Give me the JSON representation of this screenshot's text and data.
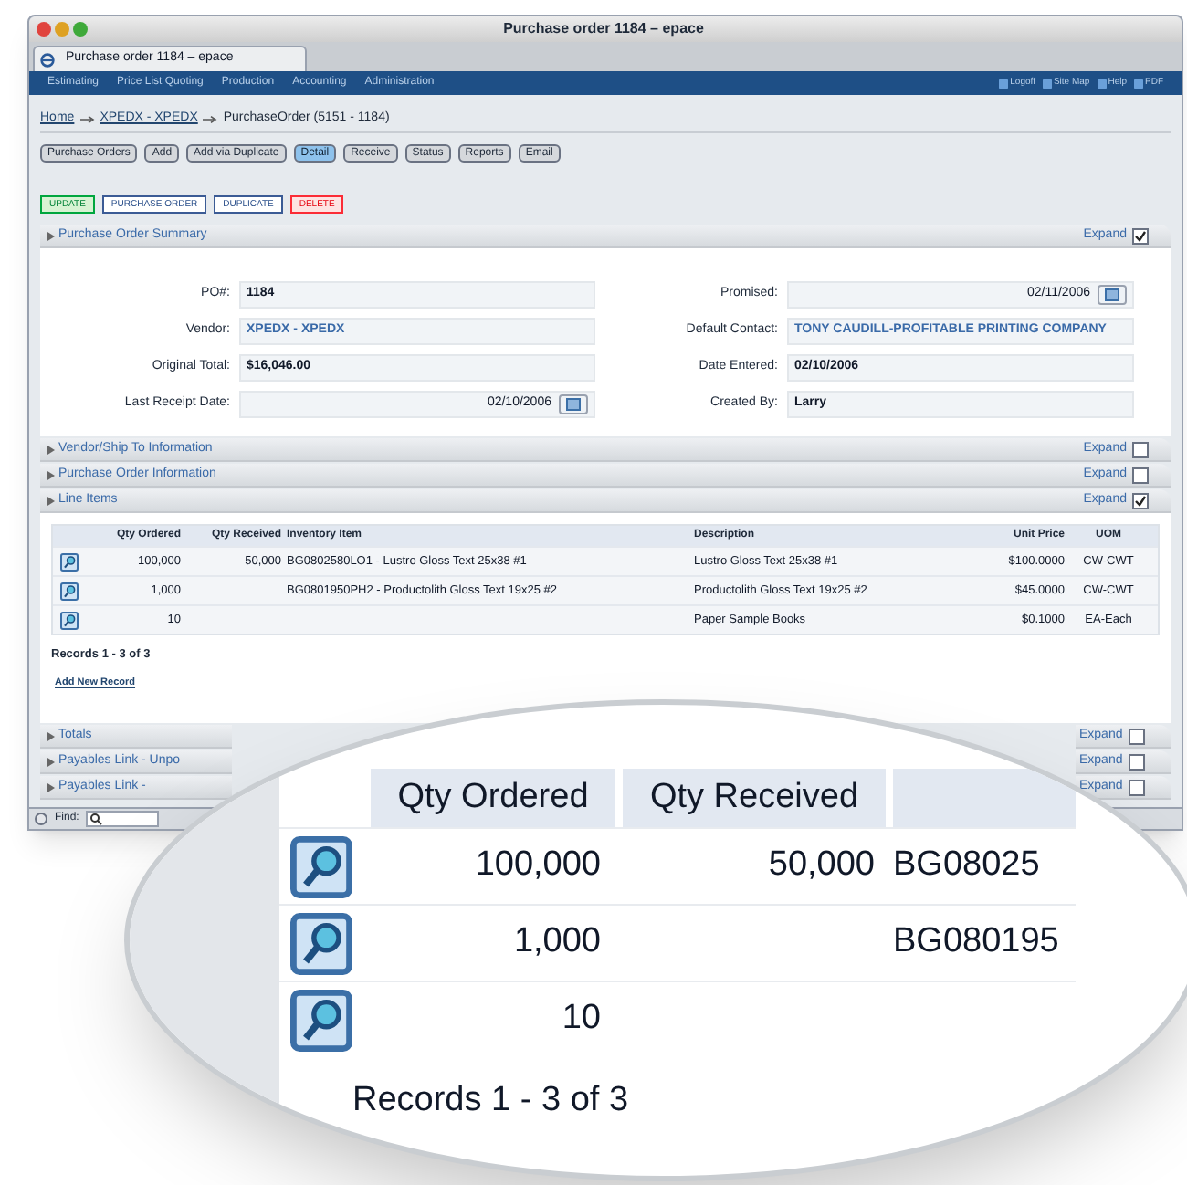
{
  "window": {
    "title": "Purchase order 1184 – epace"
  },
  "browser_tab": {
    "label": "Purchase order 1184 – epace"
  },
  "nav": {
    "items": [
      "Estimating",
      "Price List Quoting",
      "Production",
      "Accounting",
      "Administration"
    ],
    "links": [
      "Logoff",
      "Site Map",
      "Help",
      "PDF"
    ]
  },
  "breadcrumb": [
    {
      "label": "Home",
      "kind": "link"
    },
    {
      "label": "XPEDX - XPEDX",
      "kind": "link"
    },
    {
      "label": "PurchaseOrder (5151 - 1184)",
      "kind": "text"
    }
  ],
  "toolbar": [
    {
      "label": "Purchase Orders",
      "selected": false
    },
    {
      "label": "Add",
      "selected": false
    },
    {
      "label": "Add via Duplicate",
      "selected": false
    },
    {
      "label": "Detail",
      "selected": true
    },
    {
      "label": "Receive",
      "selected": false
    },
    {
      "label": "Status",
      "selected": false
    },
    {
      "label": "Reports",
      "selected": false
    },
    {
      "label": "Email",
      "selected": false
    }
  ],
  "actions": [
    {
      "label": "UPDATE",
      "kind": "update"
    },
    {
      "label": "PURCHASE ORDER",
      "kind": "normal"
    },
    {
      "label": "DUPLICATE",
      "kind": "normal"
    },
    {
      "label": "DELETE",
      "kind": "delete"
    }
  ],
  "summary": {
    "title": "Purchase Order Summary",
    "expand_label": "Expand",
    "expanded": true,
    "left": [
      {
        "label": "PO#:",
        "value": "1184",
        "kind": "text"
      },
      {
        "label": "Vendor:",
        "value": "XPEDX - XPEDX",
        "kind": "link"
      },
      {
        "label": "Original Total:",
        "value": "$16,046.00",
        "kind": "text"
      },
      {
        "label": "Last Receipt Date:",
        "value": "02/10/2006",
        "kind": "date"
      }
    ],
    "right": [
      {
        "label": "Promised:",
        "value": "02/11/2006",
        "kind": "date"
      },
      {
        "label": "Default Contact:",
        "value": "TONY CAUDILL-PROFITABLE PRINTING COMPANY",
        "kind": "link"
      },
      {
        "label": "Date Entered:",
        "value": "02/10/2006",
        "kind": "text"
      },
      {
        "label": "Created By:",
        "value": "Larry",
        "kind": "text"
      }
    ]
  },
  "sections": [
    {
      "title": "Vendor/Ship To Information",
      "expand_label": "Expand",
      "expanded": false
    },
    {
      "title": "Purchase Order Information",
      "expand_label": "Expand",
      "expanded": false
    },
    {
      "title": "Line Items",
      "expand_label": "Expand",
      "expanded": true
    }
  ],
  "line_items": {
    "columns": [
      "Qty Ordered",
      "Qty Received",
      "Inventory Item",
      "Description",
      "Unit Price",
      "UOM"
    ],
    "rows": [
      {
        "qty_ordered": "100,000",
        "qty_received": "50,000",
        "inventory_item": "BG0802580LO1 - Lustro Gloss Text 25x38 #1",
        "description": "Lustro Gloss Text 25x38 #1",
        "unit_price": "$100.0000",
        "uom": "CW-CWT"
      },
      {
        "qty_ordered": "1,000",
        "inventory_item": "BG0801950PH2 - Productolith Gloss Text 19x25 #2",
        "description": "Productolith Gloss Text 19x25 #2",
        "unit_price": "$45.0000",
        "uom": "CW-CWT"
      },
      {
        "qty_ordered": "10",
        "description": "Paper Sample Books",
        "unit_price": "$0.1000",
        "uom": "EA-Each"
      }
    ],
    "records": "Records 1 - 3 of 3",
    "add_link": "Add New Record"
  },
  "lower_sections": [
    {
      "title": "Totals",
      "expand_label": "Expand",
      "expanded": false
    },
    {
      "title": "Payables Link - Unpo",
      "expand_label": "Expand",
      "expanded": false
    },
    {
      "title": "Payables Link -",
      "expand_label": "Expand",
      "expanded": false
    }
  ],
  "find_bar": {
    "label": "Find:"
  },
  "magnifier": {
    "columns": [
      "Qty Ordered",
      "Qty Received"
    ],
    "rows": [
      {
        "qty_ordered": "100,000",
        "qty_received": "50,000",
        "inventory_item": "BG08025"
      },
      {
        "qty_ordered": "1,000",
        "inventory_item": "BG080195"
      },
      {
        "qty_ordered": "10"
      }
    ],
    "records": "Records 1 - 3 of 3"
  }
}
